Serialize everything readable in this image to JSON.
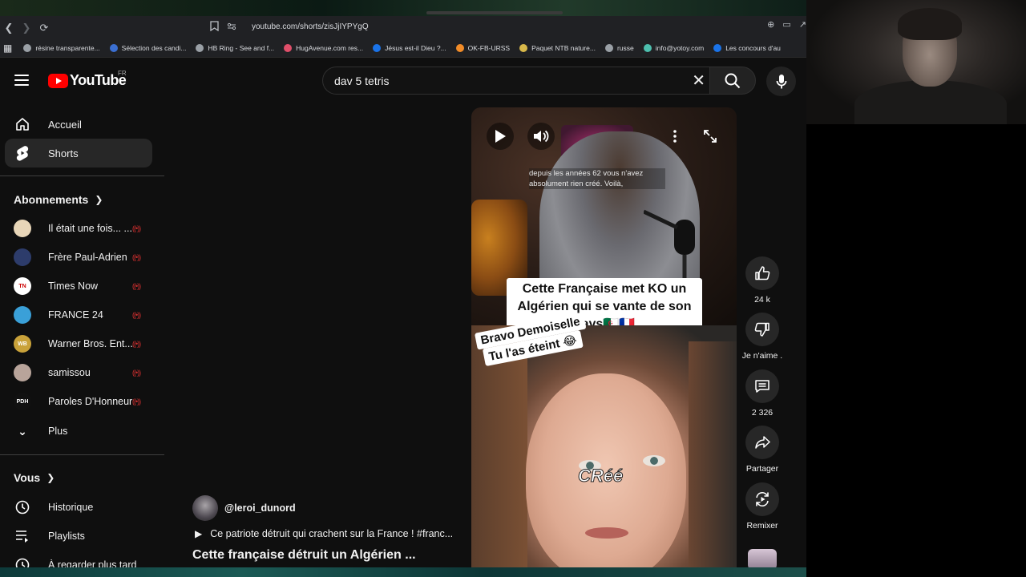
{
  "browser": {
    "url": "youtube.com/shorts/zisJjIYPYgQ",
    "bookmarks": [
      {
        "label": "résine transparente...",
        "color": "#9aa0a6"
      },
      {
        "label": "Sélection des candi...",
        "color": "#3b6fd1"
      },
      {
        "label": "HB Ring - See and f...",
        "color": "#9aa0a6"
      },
      {
        "label": "HugAvenue.com res...",
        "color": "#e04f6a"
      },
      {
        "label": "Jésus est-il Dieu ?...",
        "color": "#1a73e8"
      },
      {
        "label": "OK-FB-URSS",
        "color": "#f28c28"
      },
      {
        "label": "Paquet NTB nature...",
        "color": "#d8b84a"
      },
      {
        "label": "russe",
        "color": "#9aa0a6"
      },
      {
        "label": "info@yotoy.com",
        "color": "#4dbfae"
      },
      {
        "label": "Les concours d'au",
        "color": "#1a73e8"
      }
    ]
  },
  "yt": {
    "logo_text": "YouTube",
    "country": "FR",
    "search_query": "dav 5 tetris",
    "nav": [
      {
        "label": "Accueil",
        "icon": "home-icon"
      },
      {
        "label": "Shorts",
        "icon": "shorts-icon"
      }
    ],
    "subs_header": "Abonnements",
    "subs": [
      {
        "label": "Il était une fois... ...",
        "color": "#e8d6b8",
        "initials": ""
      },
      {
        "label": "Frère Paul-Adrien",
        "color": "#2d3c6b",
        "initials": ""
      },
      {
        "label": "Times Now",
        "color": "#ffffff",
        "initials": "TN"
      },
      {
        "label": "FRANCE 24",
        "color": "#3aa0d8",
        "initials": ""
      },
      {
        "label": "Warner Bros. Ent...",
        "color": "#c9a23a",
        "initials": "WB"
      },
      {
        "label": "samissou",
        "color": "#b8a49a",
        "initials": ""
      },
      {
        "label": "Paroles D'Honneur",
        "color": "#111111",
        "initials": "PDH"
      }
    ],
    "more_label": "Plus",
    "you_header": "Vous",
    "you_items": [
      {
        "label": "Historique",
        "icon": "history-icon"
      },
      {
        "label": "Playlists",
        "icon": "playlist-icon"
      },
      {
        "label": "À regarder plus tard",
        "icon": "watch-later-icon"
      }
    ]
  },
  "short": {
    "caption": "depuis les années 62 vous n'avez absolument rien créé. Voilà,",
    "title_overlay": "Cette Française met KO un Algérien qui se vante de son pays🇩🇿🇫🇷",
    "sticker_line1": "Bravo Demoiselle",
    "sticker_line2": "Tu l'as éteint 😂",
    "subtitle_word": "CRéé",
    "channel": "@leroi_dunord",
    "description": "Ce patriote détruit qui crachent sur la France ! #franc...",
    "video_title": "Cette française détruit un Algérien ..."
  },
  "actions": {
    "like_count": "24 k",
    "dislike_label": "Je n'aime .",
    "comment_count": "2 326",
    "share_label": "Partager",
    "remix_label": "Remixer"
  }
}
